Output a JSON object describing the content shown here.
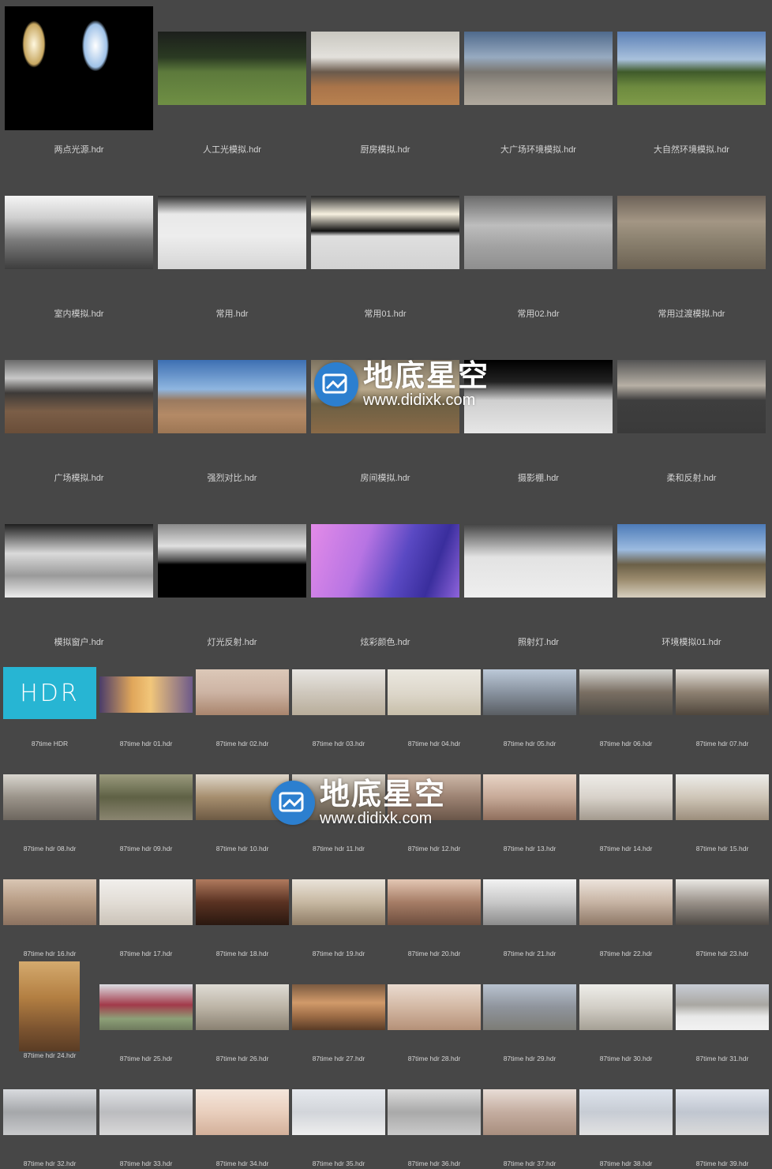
{
  "large_items": [
    {
      "label": "两点光源.hdr",
      "bg": "#000"
    },
    {
      "label": "人工光模拟.hdr",
      "bg": "linear-gradient(#1c1f1c 0%,#2a3a22 35%,#5d7a3c 55%,#6f8f44 100%)"
    },
    {
      "label": "厨房模拟.hdr",
      "bg": "linear-gradient(#c9c7c0 0%,#e3e1dc 35%,#6a5a4c 55%,#a9744a 75%,#b8814f 100%)"
    },
    {
      "label": "大广场环境模拟.hdr",
      "bg": "linear-gradient(#4f6a8c 0%,#97aac0 35%,#7a7670 55%,#9a948a 75%,#b0a99e 100%)"
    },
    {
      "label": "大自然环境模拟.hdr",
      "bg": "linear-gradient(#5b80b6 0%,#a9c1dc 38%,#3f5a2a 55%,#6d8a3f 75%,#7e9a48 100%)"
    },
    {
      "label": "室内模拟.hdr",
      "bg": "linear-gradient(#f5f5f5 0%,#cfcfcf 30%,#7d7d7d 60%,#3d3d3d 100%)"
    },
    {
      "label": "常用.hdr",
      "bg": "linear-gradient(#2e2e2e 0%,#e9e9e9 25%,#ededed 55%,#d6d6d6 100%)"
    },
    {
      "label": "常用01.hdr",
      "bg": "linear-gradient(#2a2a2a 0%,#f7f1e0 25%,#111 48%,#dfdfdf 55%,#d2d2d2 100%)"
    },
    {
      "label": "常用02.hdr",
      "bg": "linear-gradient(#6b6b6b 0%,#bdbdbd 40%,#a1a1a1 70%,#8f8f8f 100%)"
    },
    {
      "label": "常用过渡模拟.hdr",
      "bg": "linear-gradient(#6d6258 0%,#a39684 35%,#8c8270 60%,#6c6253 100%)"
    },
    {
      "label": "广场模拟.hdr",
      "bg": "linear-gradient(#6a6a6a 0%,#c8c8c8 25%,#3d3a38 45%,#7b5e47 70%,#6a4e39 100%)"
    },
    {
      "label": "强烈对比.hdr",
      "bg": "linear-gradient(#3d6fb2 0%,#8fb6e0 40%,#9a7a5f 55%,#b48a66 75%,#9c7654 100%)"
    },
    {
      "label": "房间模拟.hdr",
      "bg": "linear-gradient(#7c7260 0%,#b9a98c 40%,#6d6044 60%,#8a6a47 100%)"
    },
    {
      "label": "摄影棚.hdr",
      "bg": "linear-gradient(#000 0%,#222 30%,#cfcfcf 55%,#e6e6e6 100%)"
    },
    {
      "label": "柔和反射.hdr",
      "bg": "linear-gradient(#545454 0%,#b7b0a5 35%,#3e3e3e 55%,#3a3a3a 100%)"
    },
    {
      "label": "模拟窗户.hdr",
      "bg": "linear-gradient(#1e1e1e 0%,#dadada 40%,#9a9a9a 70%,#ececec 100%)"
    },
    {
      "label": "灯光反射.hdr",
      "bg": "linear-gradient(#8a8a8a 0%,#e0e0e0 30%,#4a4a4a 50%,#000 55%,#000 100%)"
    },
    {
      "label": "炫彩颜色.hdr",
      "bg": "linear-gradient(110deg,#e38be8 0%,#b774e3 35%,#5a49c3 60%,#3a2e9d 80%,#8e63db 100%)"
    },
    {
      "label": "照射灯.hdr",
      "bg": "linear-gradient(#444 0%,#8a8a8a 20%,#e3e3e3 45%,#eeeeee 100%)"
    },
    {
      "label": "环境模拟01.hdr",
      "bg": "linear-gradient(#4d7bb8 0%,#9cbbe0 35%,#6b6048 55%,#9a8a6c 75%,#d7cfbf 100%)"
    }
  ],
  "small_items": [
    {
      "label": "87time HDR",
      "bg": "#27b5d3",
      "logo": "HDR"
    },
    {
      "label": "87time hdr 01.hdr",
      "bg": "linear-gradient(90deg,#4b3d6a 0%,#e0a65a 35%,#f1c67a 55%,#6d5a8a 100%)"
    },
    {
      "label": "87time hdr 02.hdr",
      "bg": "linear-gradient(#dcc8b8 0%,#cdb4a4 50%,#a9856d 100%)"
    },
    {
      "label": "87time hdr 03.hdr",
      "bg": "linear-gradient(#e8e6e2 0%,#cfc8bd 50%,#b8ad9a 100%)"
    },
    {
      "label": "87time hdr 04.hdr",
      "bg": "linear-gradient(#ebe8e0 0%,#dcd6c9 55%,#c7bea9 100%)"
    },
    {
      "label": "87time hdr 05.hdr",
      "bg": "linear-gradient(#bcc9d8 0%,#8993a0 50%,#5a5e63 100%)"
    },
    {
      "label": "87time hdr 06.hdr",
      "bg": "linear-gradient(#d4d4d0 0%,#7a6f63 50%,#4d4a44 100%)"
    },
    {
      "label": "87time hdr 07.hdr",
      "bg": "linear-gradient(#e6e2dc 0%,#8e8172 50%,#4f463c 100%)"
    },
    {
      "label": "87time hdr 08.hdr",
      "bg": "linear-gradient(#d9d6cf 0%,#9b948a 50%,#6d665e 100%)"
    },
    {
      "label": "87time hdr 09.hdr",
      "bg": "linear-gradient(#9a9a7d 0%,#5f6145 50%,#8a8570 100%)"
    },
    {
      "label": "87time hdr 10.hdr",
      "bg": "linear-gradient(#e0d8cb 0%,#a68e6e 50%,#6d5a44 100%)"
    },
    {
      "label": "87time hdr 11.hdr",
      "bg": "linear-gradient(#d6d0c6 0%,#8b7f70 50%,#5e5549 100%)"
    },
    {
      "label": "87time hdr 12.hdr",
      "bg": "linear-gradient(#cdb8a8 0%,#9c8272 50%,#6a5649 100%)"
    },
    {
      "label": "87time hdr 13.hdr",
      "bg": "linear-gradient(#e8d4c6 0%,#c7aa98 50%,#8f6f5d 100%)"
    },
    {
      "label": "87time hdr 14.hdr",
      "bg": "linear-gradient(#eeece8 0%,#d8d2ca 50%,#a39a8e 100%)"
    },
    {
      "label": "87time hdr 15.hdr",
      "bg": "linear-gradient(#ededea 0%,#cfc6b8 50%,#9c8e7c 100%)"
    },
    {
      "label": "87time hdr 16.hdr",
      "bg": "linear-gradient(#d9c6b4 0%,#b79c84 50%,#8c7260 100%)"
    },
    {
      "label": "87time hdr 17.hdr",
      "bg": "linear-gradient(#f1efec 0%,#e2ddd6 50%,#cbc3b8 100%)"
    },
    {
      "label": "87time hdr 18.hdr",
      "bg": "linear-gradient(#b07a5e 0%,#5a3222 50%,#2a1810 100%)"
    },
    {
      "label": "87time hdr 19.hdr",
      "bg": "linear-gradient(#eae4da 0%,#c7b8a2 50%,#8f7d66 100%)"
    },
    {
      "label": "87time hdr 20.hdr",
      "bg": "linear-gradient(#e4c7b4 0%,#a67d66 50%,#6d4e3e 100%)"
    },
    {
      "label": "87time hdr 21.hdr",
      "bg": "linear-gradient(#f2f2f2 0%,#c8c8c8 50%,#8c8c8c 100%)"
    },
    {
      "label": "87time hdr 22.hdr",
      "bg": "linear-gradient(#ede4dc 0%,#c7b4a4 50%,#8e7867 100%)"
    },
    {
      "label": "87time hdr 23.hdr",
      "bg": "linear-gradient(#eae8e4 0%,#9a928a 50%,#4f4a45 100%)"
    },
    {
      "label": "87time hdr 24.hdr",
      "bg": "linear-gradient(#d4aa6e 0%,#b37f42 40%,#7c5430 75%,#5a3c24 100%)"
    },
    {
      "label": "87time hdr 25.hdr",
      "bg": "linear-gradient(#dcdde3 0%,#a23a4a 45%,#8da078 75%,#6f7a5d 100%)"
    },
    {
      "label": "87time hdr 26.hdr",
      "bg": "linear-gradient(#dfdcd5 0%,#bcb4a6 50%,#8a8172 100%)"
    },
    {
      "label": "87time hdr 27.hdr",
      "bg": "linear-gradient(#7a5a40 0%,#d19a6a 40%,#9c6c46 70%,#5a3c26 100%)"
    },
    {
      "label": "87time hdr 28.hdr",
      "bg": "linear-gradient(#eadbd0 0%,#d3b8a4 50%,#b59178 100%)"
    },
    {
      "label": "87time hdr 29.hdr",
      "bg": "linear-gradient(#b9c3d0 0%,#8f949c 50%,#7c7c76 100%)"
    },
    {
      "label": "87time hdr 30.hdr",
      "bg": "linear-gradient(#eeeeea 0%,#d2cec6 50%,#a5a095 100%)"
    },
    {
      "label": "87time hdr 31.hdr",
      "bg": "linear-gradient(#c8cdd6 0%,#a9a7a2 45%,#e8e8e8 70%,#f2f2f2 100%)"
    },
    {
      "label": "87time hdr 32.hdr",
      "bg": "linear-gradient(#d9dbdf 0%,#a5a7aa 50%,#c9cacc 100%)"
    },
    {
      "label": "87time hdr 33.hdr",
      "bg": "linear-gradient(#e0e2e6 0%,#bbbcbf 50%,#d8d8d8 100%)"
    },
    {
      "label": "87time hdr 34.hdr",
      "bg": "linear-gradient(#f4e6dc 0%,#e9cfbd 50%,#d3b09a 100%)"
    },
    {
      "label": "87time hdr 35.hdr",
      "bg": "linear-gradient(#e6e9ee 0%,#d2d5da 50%,#eeeeee 100%)"
    },
    {
      "label": "87time hdr 36.hdr",
      "bg": "linear-gradient(#dcdcdc 0%,#a9a9a9 50%,#cacaca 100%)"
    },
    {
      "label": "87time hdr 37.hdr",
      "bg": "linear-gradient(#e8ddd6 0%,#c4ada0 50%,#a88e7e 100%)"
    },
    {
      "label": "87time hdr 38.hdr",
      "bg": "linear-gradient(#dde3ec 0%,#c7ccd4 50%,#e2e2e2 100%)"
    },
    {
      "label": "87time hdr 39.hdr",
      "bg": "linear-gradient(#e2e6ee 0%,#c0c6d0 50%,#dadada 100%)"
    }
  ],
  "watermark": {
    "brand_cn": "地底星空",
    "brand_url": "www.didixk.com",
    "icon": "image-frame-icon"
  }
}
